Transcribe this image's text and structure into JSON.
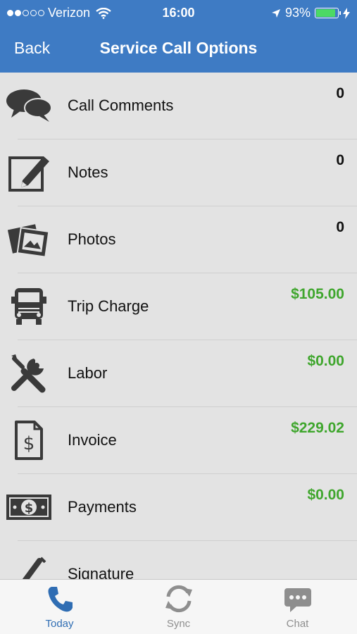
{
  "status_bar": {
    "carrier": "Verizon",
    "time": "16:00",
    "battery": "93%",
    "battery_level": 0.93
  },
  "nav": {
    "back_label": "Back",
    "title": "Service Call Options"
  },
  "rows": [
    {
      "label": "Call Comments",
      "value": "0",
      "icon": "speech-bubbles-icon",
      "is_money": false
    },
    {
      "label": "Notes",
      "value": "0",
      "icon": "pencil-square-icon",
      "is_money": false
    },
    {
      "label": "Photos",
      "value": "0",
      "icon": "photos-icon",
      "is_money": false
    },
    {
      "label": "Trip Charge",
      "value": "$105.00",
      "icon": "truck-icon",
      "is_money": true
    },
    {
      "label": "Labor",
      "value": "$0.00",
      "icon": "wrench-screwdriver-icon",
      "is_money": true
    },
    {
      "label": "Invoice",
      "value": "$229.02",
      "icon": "invoice-dollar-icon",
      "is_money": true
    },
    {
      "label": "Payments",
      "value": "$0.00",
      "icon": "cash-bill-icon",
      "is_money": true
    },
    {
      "label": "Signature",
      "value": "",
      "icon": "pen-icon",
      "is_money": false
    }
  ],
  "tabs": [
    {
      "label": "Today",
      "icon": "phone-icon",
      "active": true
    },
    {
      "label": "Sync",
      "icon": "sync-icon",
      "active": false
    },
    {
      "label": "Chat",
      "icon": "chat-bubble-icon",
      "active": false
    }
  ],
  "colors": {
    "header": "#3e7bc4",
    "money": "#3fa62d",
    "active_tab": "#2f6db3",
    "inactive_tab": "#8e8e8e"
  }
}
